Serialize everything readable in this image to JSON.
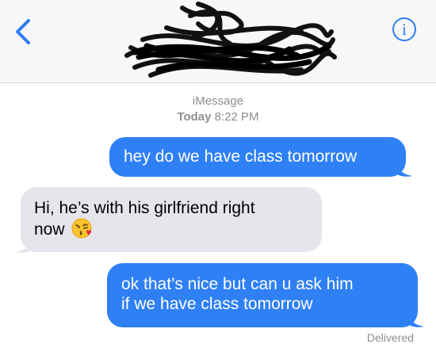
{
  "header": {
    "back_icon": "chevron-left-icon",
    "info_label": "i",
    "contact_redacted": true
  },
  "conversation": {
    "service": "iMessage",
    "timestamp_day": "Today",
    "timestamp_time": "8:22 PM"
  },
  "messages": [
    {
      "direction": "outgoing",
      "text": "hey do we have class tomorrow"
    },
    {
      "direction": "incoming",
      "text_line1": "Hi, he’s with his girlfriend right",
      "text_line2": "now",
      "emoji": "face-blowing-kiss"
    },
    {
      "direction": "outgoing",
      "text_line1": "ok that’s nice but can u ask him",
      "text_line2": "if we have class tomorrow"
    }
  ],
  "status": {
    "delivered": "Delivered"
  },
  "colors": {
    "outgoing_bubble": "#2f80f5",
    "incoming_bubble": "#e6e5eb",
    "accent": "#2e7cf6",
    "meta_text": "#8e8e93"
  }
}
